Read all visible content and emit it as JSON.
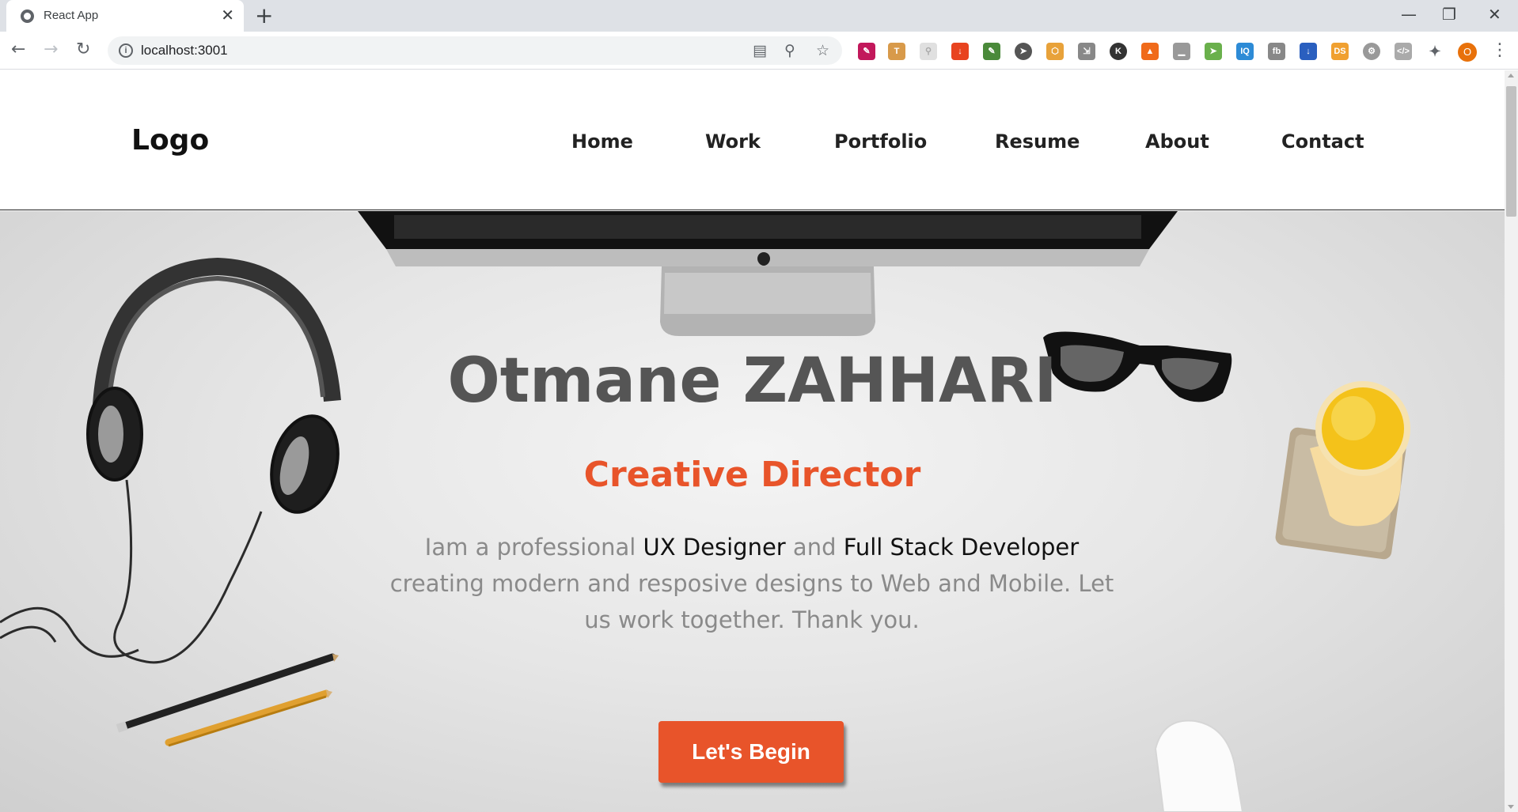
{
  "browser": {
    "tab_title": "React App",
    "tab_close": "✕",
    "new_tab": "+",
    "url": "localhost:3001",
    "profile_initial": "O"
  },
  "header": {
    "logo": "Logo",
    "nav": [
      "Home",
      "Work",
      "Portfolio",
      "Resume",
      "About",
      "Contact"
    ]
  },
  "hero": {
    "name": "Otmane ZAHHARI",
    "role": "Creative Director",
    "desc_part1": "Iam a professional ",
    "desc_hl1": "UX Designer",
    "desc_part2": " and ",
    "desc_hl2": "Full Stack Developer",
    "desc_part3": " creating modern and resposive designs to Web and Mobile. Let us work together. Thank you.",
    "cta": "Let's Begin"
  },
  "colors": {
    "accent": "#e8542a",
    "title": "#555555",
    "body_text": "#8a8a8a"
  }
}
